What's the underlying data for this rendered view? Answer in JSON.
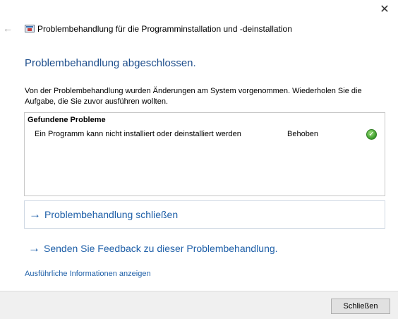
{
  "window": {
    "close_glyph": "✕",
    "back_glyph": "←",
    "title": "Problembehandlung für die Programminstallation und -deinstallation",
    "title_icon": "troubleshooter-icon"
  },
  "main": {
    "heading": "Problembehandlung abgeschlossen.",
    "description": "Von der Problembehandlung wurden Änderungen am System vorgenommen. Wiederholen Sie die Aufgabe, die Sie zuvor ausführen wollten."
  },
  "problems": {
    "header": "Gefundene Probleme",
    "items": [
      {
        "text": "Ein Programm kann nicht installiert oder deinstalliert werden",
        "status": "Behoben",
        "status_icon": "green-check-icon",
        "status_glyph": "✓"
      }
    ]
  },
  "commands": {
    "arrow_glyph": "→",
    "close_troubleshooter": "Problembehandlung schließen",
    "send_feedback": "Senden Sie Feedback zu dieser Problembehandlung."
  },
  "details_link": "Ausführliche Informationen anzeigen",
  "footer": {
    "close_button": "Schließen"
  },
  "colors": {
    "accent": "#1e5fa8",
    "heading": "#1e4e8c",
    "success": "#3a9a2a"
  }
}
